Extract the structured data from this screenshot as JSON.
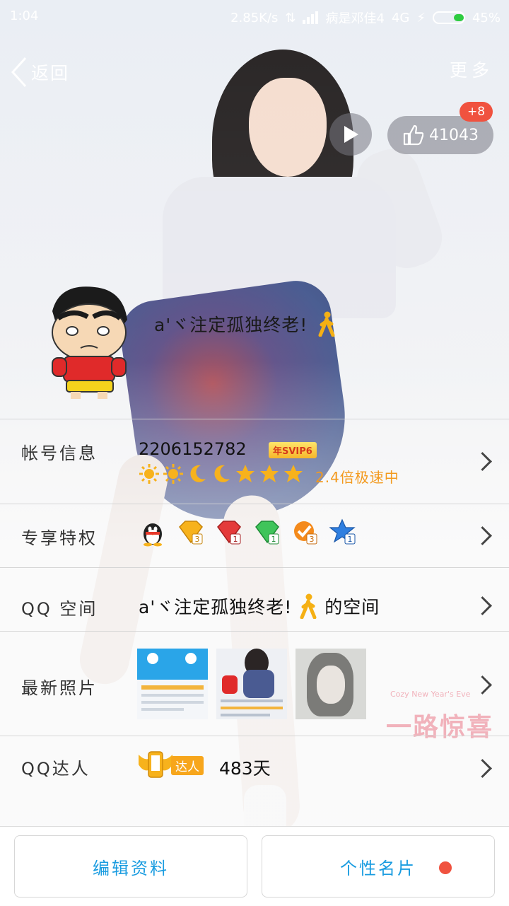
{
  "status_bar": {
    "time": "1:04",
    "speed": "2.85K/s",
    "carrier": "病是邓佳4",
    "network": "4G",
    "battery": "45%"
  },
  "nav": {
    "back_label": "返回",
    "more_label": "更多"
  },
  "likes": {
    "count": "41043",
    "badge": "+8"
  },
  "profile": {
    "nickname": "a'ヾ注定孤独终老!"
  },
  "account": {
    "label": "帐号信息",
    "qq_number": "2206152782",
    "vip_badge": "年SVIP6",
    "level_icons": [
      "sun",
      "sun",
      "moon",
      "moon",
      "star",
      "star",
      "star"
    ],
    "speed_text": "2.4倍极速中"
  },
  "privileges": {
    "label": "专享特权",
    "icons": [
      "qq-penguin-icon",
      "yellow-diamond-icon",
      "red-diamond-icon",
      "green-diamond-icon",
      "orange-check-icon",
      "blue-star-icon"
    ]
  },
  "qzone": {
    "label": "QQ 空间",
    "name": "a'ヾ注定孤独终老!",
    "suffix": "的空间"
  },
  "photos": {
    "label": "最新照片",
    "watermark": "一路惊喜",
    "watermark_sub": "Cozy New Year's Eve"
  },
  "talent": {
    "label": "QQ达人",
    "badge": "达人",
    "days": "483天"
  },
  "bottom": {
    "edit_label": "编辑资料",
    "card_label": "个性名片"
  },
  "colors": {
    "accent": "#1a9ce0",
    "badge_red": "#f0523f",
    "speed_orange": "#f39a1e"
  }
}
